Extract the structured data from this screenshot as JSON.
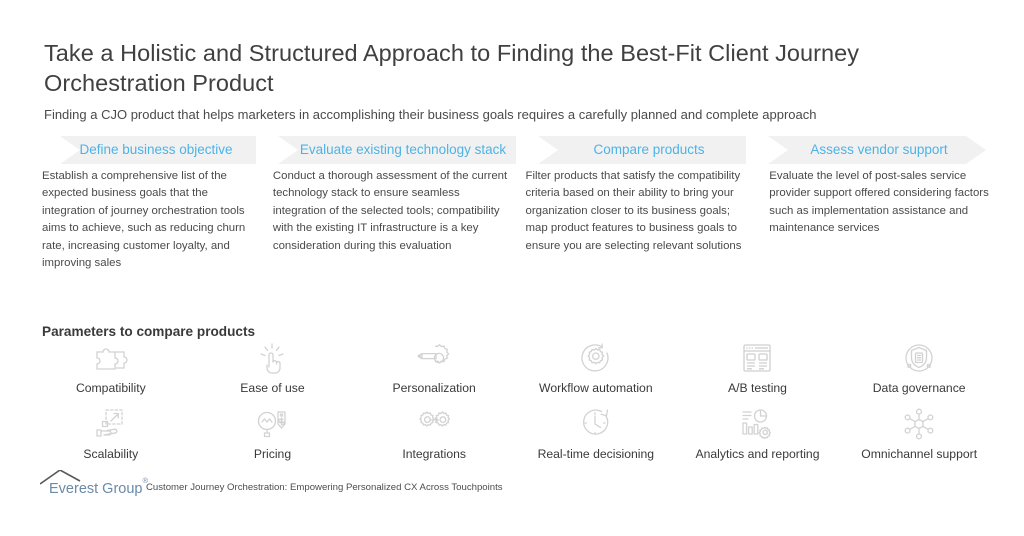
{
  "slide": {
    "title": "Take a Holistic and Structured Approach to Finding the Best-Fit Client Journey Orchestration Product",
    "subtitle": "Finding a CJO product that helps marketers in accomplishing their business goals requires a carefully planned and complete approach",
    "accent_color": "#4db3e6",
    "band_color": "#f1f1f1"
  },
  "process": {
    "steps": [
      {
        "label": "Define business objective",
        "description": "Establish a comprehensive list of the expected business goals that the integration of journey orchestration tools aims to achieve, such as reducing churn rate, increasing customer loyalty, and improving sales"
      },
      {
        "label": "Evaluate existing technology stack",
        "description": "Conduct a thorough assessment of the current technology stack to ensure seamless integration of the selected tools; compatibility with the existing IT infrastructure is a key consideration during this evaluation"
      },
      {
        "label": "Compare products",
        "description": "Filter products that satisfy the compatibility criteria based on their ability to bring your organization closer to its business goals; map product features to business goals to ensure you are selecting relevant solutions"
      },
      {
        "label": "Assess vendor support",
        "description": "Evaluate the level of post-sales service provider support offered considering factors such as implementation assistance and maintenance services"
      }
    ]
  },
  "parameters": {
    "heading": "Parameters to compare products",
    "items": [
      {
        "label": "Compatibility",
        "icon": "puzzle-icon"
      },
      {
        "label": "Ease of use",
        "icon": "tap-hand-icon"
      },
      {
        "label": "Personalization",
        "icon": "gear-pencil-icon"
      },
      {
        "label": "Workflow automation",
        "icon": "gear-refresh-icon"
      },
      {
        "label": "A/B testing",
        "icon": "ab-test-icon"
      },
      {
        "label": "Data governance",
        "icon": "shield-data-icon"
      },
      {
        "label": "Scalability",
        "icon": "hand-growth-icon"
      },
      {
        "label": "Pricing",
        "icon": "magnifier-price-tag-icon"
      },
      {
        "label": "Integrations",
        "icon": "gears-arrow-icon"
      },
      {
        "label": "Real-time decisioning",
        "icon": "clock-refresh-icon"
      },
      {
        "label": "Analytics and reporting",
        "icon": "chart-gear-icon"
      },
      {
        "label": "Omnichannel support",
        "icon": "network-nodes-icon"
      }
    ]
  },
  "footer": {
    "logo_text": "Everest Group",
    "logo_trademark": "®",
    "caption": "Customer Journey Orchestration: Empowering Personalized CX Across Touchpoints"
  }
}
